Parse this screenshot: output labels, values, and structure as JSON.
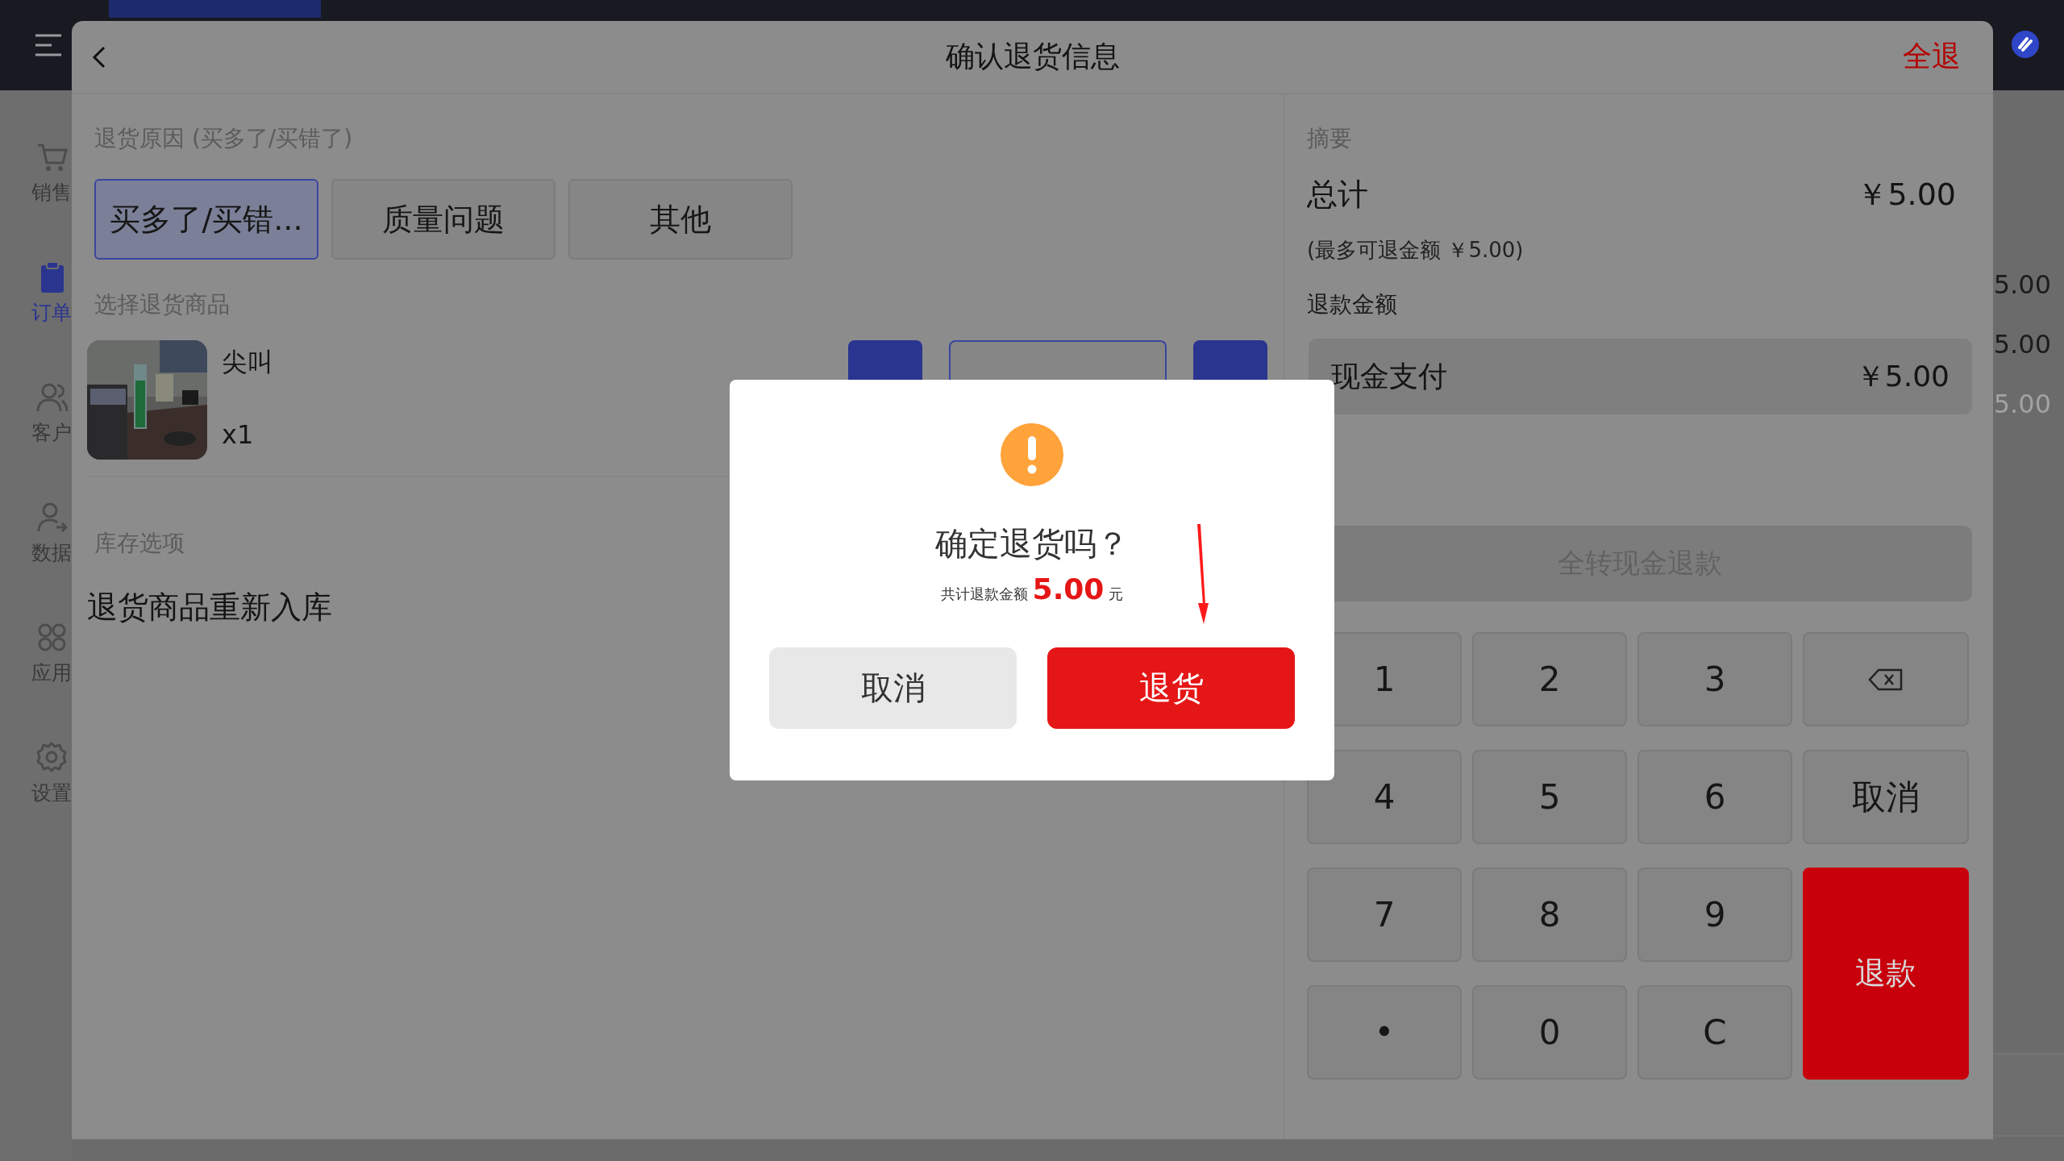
{
  "sidebar": {
    "items": [
      {
        "label": "销售",
        "selected": false
      },
      {
        "label": "订单",
        "selected": true
      },
      {
        "label": "客户",
        "selected": false
      },
      {
        "label": "数据",
        "selected": false
      },
      {
        "label": "应用",
        "selected": false
      },
      {
        "label": "设置",
        "selected": false
      }
    ]
  },
  "background_values": [
    {
      "text": "5.00",
      "muted": false
    },
    {
      "text": "5.00",
      "muted": false
    },
    {
      "text": "5.00",
      "muted": true
    }
  ],
  "sheet": {
    "title": "确认退货信息",
    "action": "全退"
  },
  "reason": {
    "label": "退货原因 (买多了/买错了)",
    "options": [
      {
        "label": "买多了/买错...",
        "selected": true
      },
      {
        "label": "质量问题",
        "selected": false
      },
      {
        "label": "其他",
        "selected": false
      }
    ]
  },
  "products": {
    "label": "选择退货商品",
    "items": [
      {
        "name": "尖叫",
        "quantity": "x1"
      }
    ]
  },
  "stock": {
    "label": "库存选项",
    "option": "退货商品重新入库"
  },
  "summary": {
    "label": "摘要",
    "total_label": "总计",
    "total": "￥5.00",
    "max_refund": "(最多可退金额 ￥5.00)",
    "refund_label": "退款金额",
    "payments": [
      {
        "method": "现金支付",
        "amount": "￥5.00"
      }
    ],
    "convert_button": {
      "label": "全转现金退款",
      "disabled": true
    }
  },
  "keypad": [
    {
      "kind": "digit",
      "label": "1"
    },
    {
      "kind": "digit",
      "label": "2"
    },
    {
      "kind": "digit",
      "label": "3"
    },
    {
      "kind": "backspace"
    },
    {
      "kind": "digit",
      "label": "4"
    },
    {
      "kind": "digit",
      "label": "5"
    },
    {
      "kind": "digit",
      "label": "6"
    },
    {
      "kind": "digit",
      "label": "取消"
    },
    {
      "kind": "digit",
      "label": "7"
    },
    {
      "kind": "digit",
      "label": "8"
    },
    {
      "kind": "digit",
      "label": "9"
    },
    {
      "kind": "submit",
      "label": "退款"
    },
    {
      "kind": "digit",
      "label": "•"
    },
    {
      "kind": "digit",
      "label": "0"
    },
    {
      "kind": "digit",
      "label": "C"
    }
  ],
  "dialog": {
    "title": "确定退货吗？",
    "amount_label": "共计退款金额",
    "amount": "5.00",
    "unit": "元",
    "buttons": [
      {
        "label": "取消",
        "kind": "secondary"
      },
      {
        "label": "退货",
        "kind": "primary"
      }
    ]
  }
}
